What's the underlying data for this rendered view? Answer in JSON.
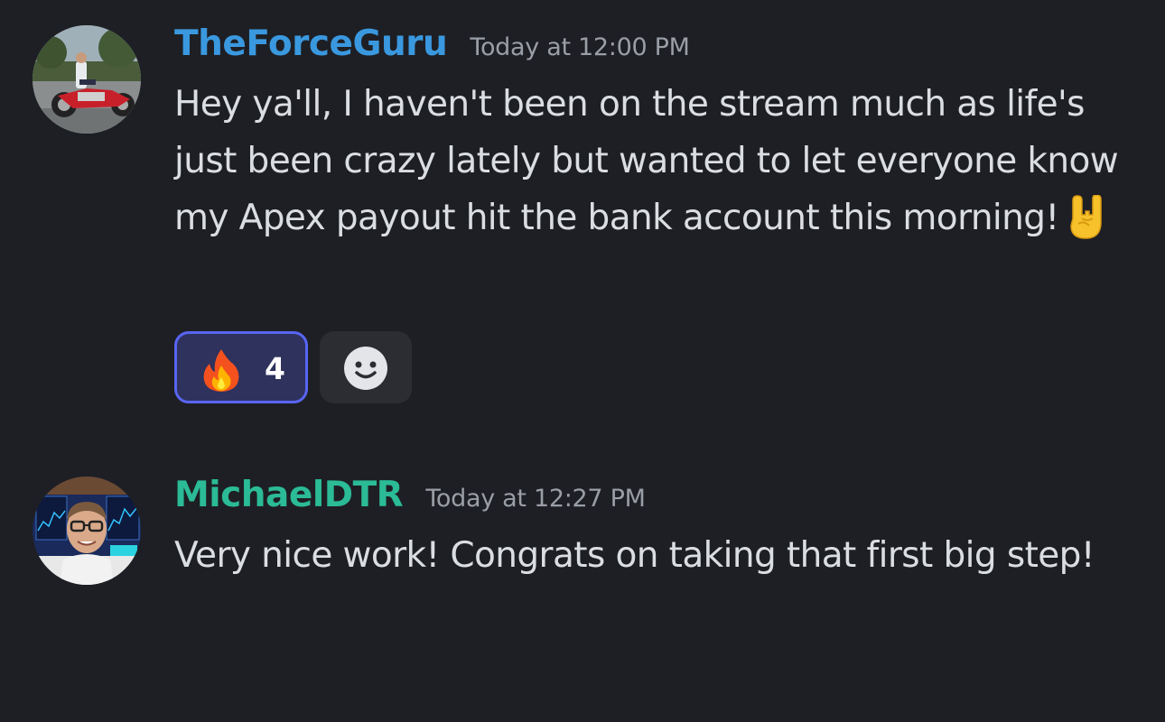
{
  "messages": [
    {
      "username": "TheForceGuru",
      "username_color": "#3a98df",
      "timestamp": "Today at 12:00 PM",
      "avatar": "avatar-motorcycle-rider",
      "text": "Hey ya'll, I haven't been on the stream much as life's just been crazy lately but wanted to let everyone know my Apex payout hit the bank account this morning!",
      "inline_emoji": "sign-of-the-horns-icon",
      "reactions": [
        {
          "emoji": "fire-icon",
          "count": "4",
          "active": true
        }
      ],
      "add_reaction_icon": "smile-icon"
    },
    {
      "username": "MichaelDTR",
      "username_color": "#2bbb96",
      "timestamp": "Today at 12:27 PM",
      "avatar": "avatar-man-with-glasses",
      "text": "Very nice work! Congrats on taking that first big step!"
    }
  ],
  "colors": {
    "background": "#1e1f24",
    "text": "#dbdee1",
    "timestamp": "#9a9ea6",
    "reaction_active_border": "#5865f2"
  }
}
